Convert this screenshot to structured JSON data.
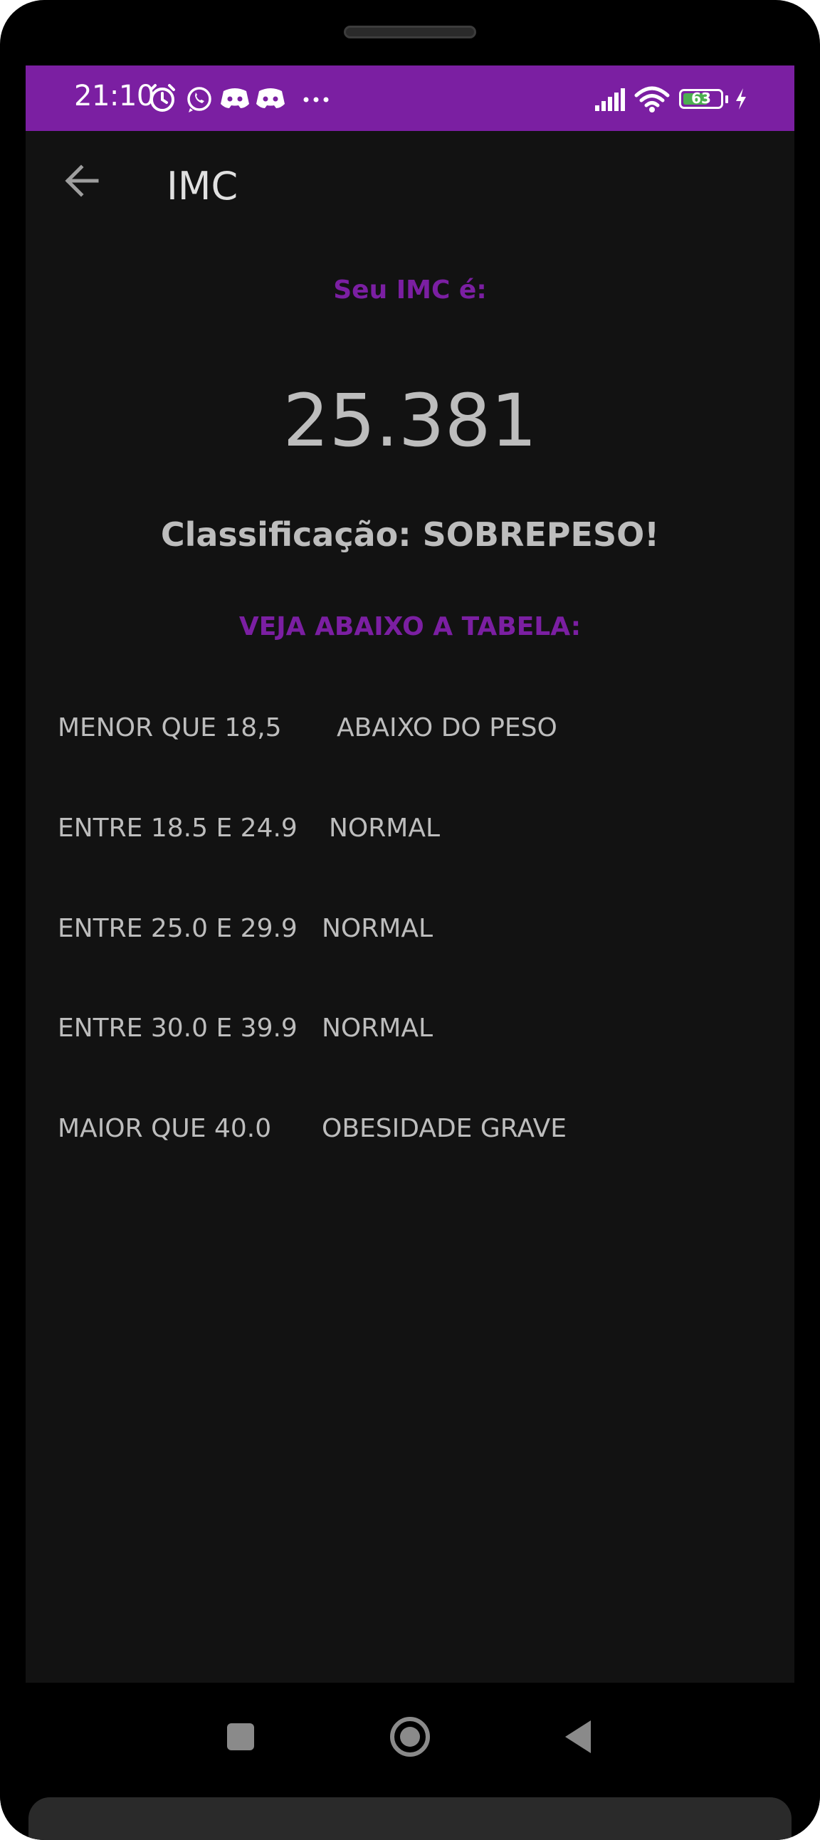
{
  "status_bar": {
    "time": "21:10",
    "icons": [
      "alarm-icon",
      "whatsapp-icon",
      "discord-icon",
      "discord-icon",
      "more-dots-icon",
      "signal-icon",
      "wifi-icon",
      "battery-icon",
      "charging-icon"
    ],
    "battery_level": "63",
    "background_color": "#7b1fa2"
  },
  "app_bar": {
    "back_icon": "arrow-back-icon",
    "title": "IMC"
  },
  "result": {
    "label": "Seu IMC é:",
    "value": "25.381",
    "classification": "Classificação: SOBREPESO!"
  },
  "table": {
    "title": "VEJA ABAIXO A TABELA:",
    "rows": [
      {
        "range": "MENOR QUE 18,5",
        "classification": "ABAIXO DO PESO"
      },
      {
        "range": "ENTRE 18.5 E 24.9",
        "classification": "NORMAL"
      },
      {
        "range": "ENTRE 25.0 E 29.9",
        "classification": "NORMAL"
      },
      {
        "range": "ENTRE 30.0 E 39.9",
        "classification": "NORMAL"
      },
      {
        "range": "MAIOR QUE 40.0",
        "classification": "OBESIDADE GRAVE"
      }
    ]
  },
  "nav_bar": {
    "icons": [
      "recent-apps-icon",
      "home-icon",
      "back-triangle-icon"
    ]
  },
  "colors": {
    "accent": "#7b1fa2",
    "background": "#121212",
    "text": "#bdbdbd"
  }
}
